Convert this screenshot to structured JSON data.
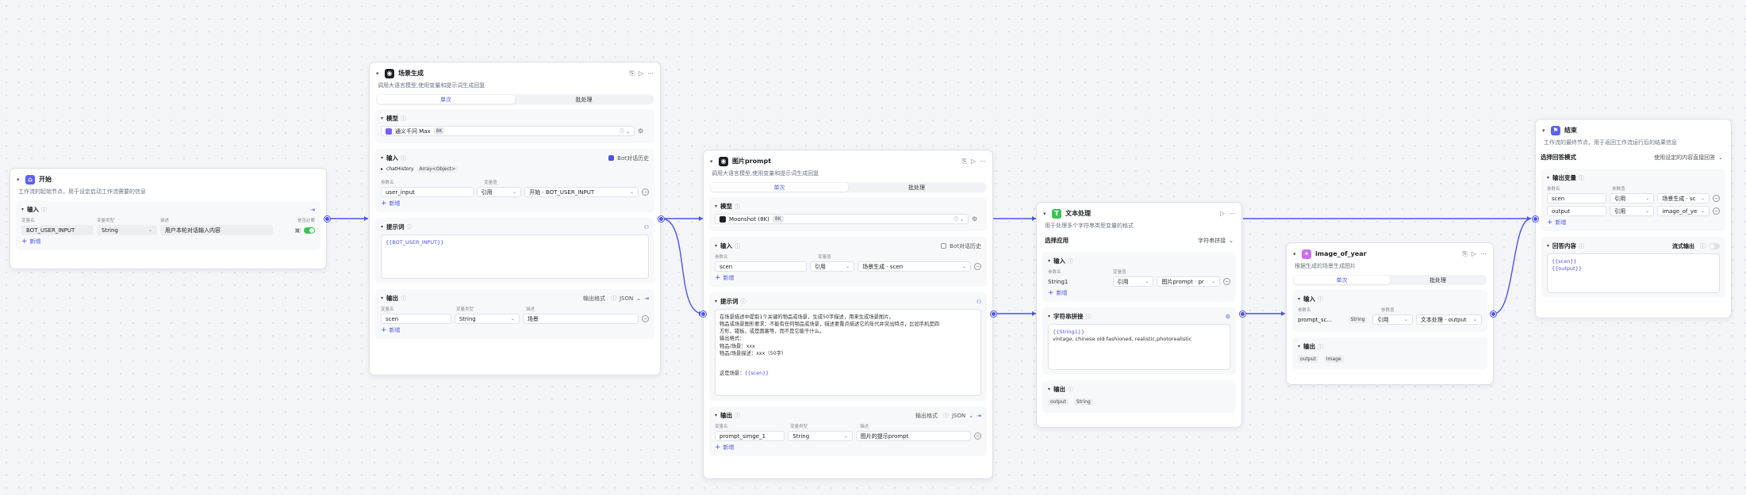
{
  "start_node": {
    "title": "开始",
    "description": "工作流的起始节点，用于设定启动工作流需要的信息",
    "input_section": "输入",
    "col_param": "变量名",
    "col_type": "变量类型",
    "col_desc": "描述",
    "col_required": "是否必要",
    "param_name": "BOT_USER_INPUT",
    "param_type": "String",
    "param_desc": "用户本轮对话输入内容",
    "add_label": "新增"
  },
  "llm_scene": {
    "title": "场景生成",
    "description": "调用大语言模型,使用变量和提示词生成回复",
    "tab_single": "单次",
    "tab_batch": "批处理",
    "model_section": "模型",
    "model_name": "通义千问 Max",
    "model_badge": "8K",
    "input_section": "输入",
    "bot_history_label": "Bot对话历史",
    "chat_history_label": "chatHistory",
    "chat_history_type": "Array<Object>",
    "col_param": "参数名",
    "col_value": "变量值",
    "input_param": "user_input",
    "input_mode": "引用",
    "input_ref": "开始 · BOT_USER_INPUT",
    "add_label": "新增",
    "prompt_section": "提示词",
    "prompt_text": "{{BOT_USER_INPUT}}",
    "output_section": "输出",
    "output_format_label": "输出格式",
    "output_format": "JSON",
    "col_var": "变量名",
    "col_type": "变量类型",
    "col_desc": "描述",
    "output_name": "scen",
    "output_type": "String",
    "output_desc": "场景"
  },
  "llm_prompt": {
    "title": "图片prompt",
    "description": "调用大语言模型,使用变量和提示词生成回复",
    "tab_single": "单次",
    "tab_batch": "批处理",
    "model_section": "模型",
    "model_name": "Moonshot (8K)",
    "model_badge": "8K",
    "input_section": "输入",
    "bot_history_label": "Bot对话历史",
    "col_param": "参数名",
    "col_value": "变量值",
    "input_param": "scen",
    "input_mode": "引用",
    "input_ref": "场景生成 · scen",
    "add_label": "新增",
    "prompt_section": "提示词",
    "prompt_lines": [
      "在场景描述中提取1个关键的物品或场景，生成50字描述，用来生成场景图片。",
      "物品或场景图形要求：不能有任何物品或场景，描述要重点描述它的年代并突出特点，比如手机是四",
      "方形、镂板，或是圆塞等，而不是它能干什么。",
      "输出格式：",
      "物品/场景：xxx",
      "物品/场景描述：xxx（50字）"
    ],
    "prompt_footer_prefix": "这是场景：",
    "prompt_footer_var": "{{scen}}",
    "output_section": "输出",
    "output_format_label": "输出格式",
    "output_format": "JSON",
    "col_var": "变量名",
    "col_type": "变量类型",
    "col_desc": "描述",
    "output_name": "prompt_simge_1",
    "output_type": "String",
    "output_desc": "图片的提示prompt"
  },
  "text_node": {
    "title": "文本处理",
    "description": "用于处理多个字符串类型变量的格式",
    "apply_label": "选择应用",
    "apply_value": "字符串拼接",
    "input_section": "输入",
    "col_param": "参数名",
    "col_value": "变量值",
    "input_param": "String1",
    "input_mode": "引用",
    "input_ref": "图片prompt · pr",
    "add_label": "新增",
    "concat_section": "字符串拼接",
    "concat_var": "{{String1}}",
    "concat_text": "vintage, chinese old fashioned, realistic,photorealistic",
    "output_section": "输出",
    "output_name": "output",
    "output_type": "String"
  },
  "image_node": {
    "title": "image_of_year",
    "description": "根据生成的场景生成图片",
    "tab_single": "单次",
    "tab_batch": "批处理",
    "input_section": "输入",
    "col_param": "参数名",
    "col_value": "参数值",
    "input_param": "prompt_sc...",
    "input_type": "String",
    "input_mode": "引用",
    "input_ref": "文本处理 · output",
    "output_section": "输出",
    "output_name": "output",
    "output_type": "Image"
  },
  "end_node": {
    "title": "结束",
    "description": "工作流的最终节点，用于返回工作流运行后的结果信息",
    "mode_label": "选择回答模式",
    "mode_value": "使用设定的内容直接回答",
    "output_section": "输出变量",
    "col_param": "参数名",
    "col_value": "参数值",
    "rows": [
      {
        "name": "scen",
        "mode": "引用",
        "ref": "场景生成 · sc"
      },
      {
        "name": "output",
        "mode": "引用",
        "ref": "image_of_ye"
      }
    ],
    "add_label": "新增",
    "answer_section": "回答内容",
    "stream_label": "流式输出",
    "answer_line1": "{{scen}}",
    "answer_line2": "{{output}}"
  },
  "colors": {
    "accent": "#4d53e8",
    "start_icon": "#5a63f0",
    "llm_icon": "#1c1f23",
    "text_icon": "#3ec254",
    "image_icon": "#c86ff0",
    "end_icon": "#5a63f0"
  }
}
